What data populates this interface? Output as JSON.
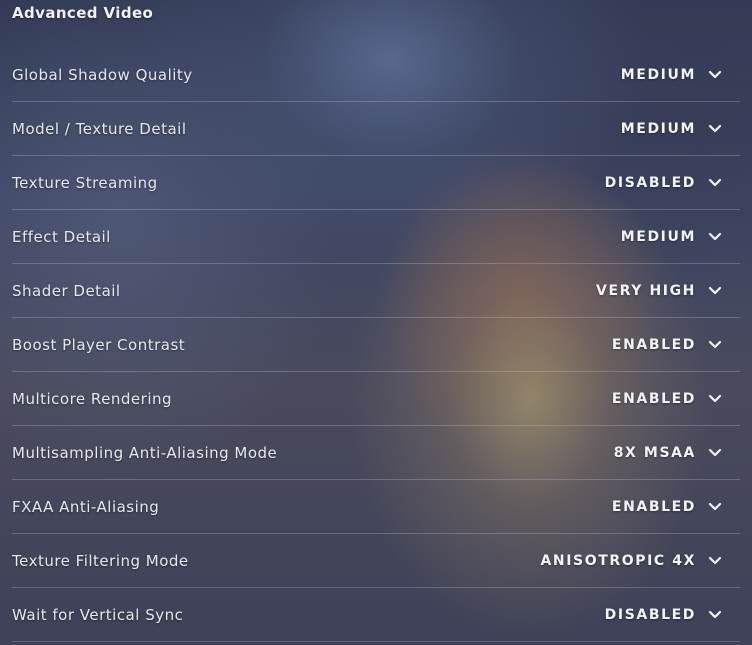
{
  "section": {
    "title": "Advanced Video"
  },
  "settings": [
    {
      "label": "Global Shadow Quality",
      "value": "MEDIUM",
      "icon": "chevron-down-icon"
    },
    {
      "label": "Model / Texture Detail",
      "value": "MEDIUM",
      "icon": "chevron-down-icon"
    },
    {
      "label": "Texture Streaming",
      "value": "DISABLED",
      "icon": "chevron-down-icon"
    },
    {
      "label": "Effect Detail",
      "value": "MEDIUM",
      "icon": "chevron-down-icon"
    },
    {
      "label": "Shader Detail",
      "value": "VERY HIGH",
      "icon": "chevron-down-icon"
    },
    {
      "label": "Boost Player Contrast",
      "value": "ENABLED",
      "icon": "chevron-down-icon"
    },
    {
      "label": "Multicore Rendering",
      "value": "ENABLED",
      "icon": "chevron-down-icon"
    },
    {
      "label": "Multisampling Anti-Aliasing Mode",
      "value": "8X MSAA",
      "icon": "chevron-down-icon"
    },
    {
      "label": "FXAA Anti-Aliasing",
      "value": "ENABLED",
      "icon": "chevron-down-icon"
    },
    {
      "label": "Texture Filtering Mode",
      "value": "ANISOTROPIC 4X",
      "icon": "chevron-down-icon"
    },
    {
      "label": "Wait for Vertical Sync",
      "value": "DISABLED",
      "icon": "chevron-down-icon"
    }
  ]
}
